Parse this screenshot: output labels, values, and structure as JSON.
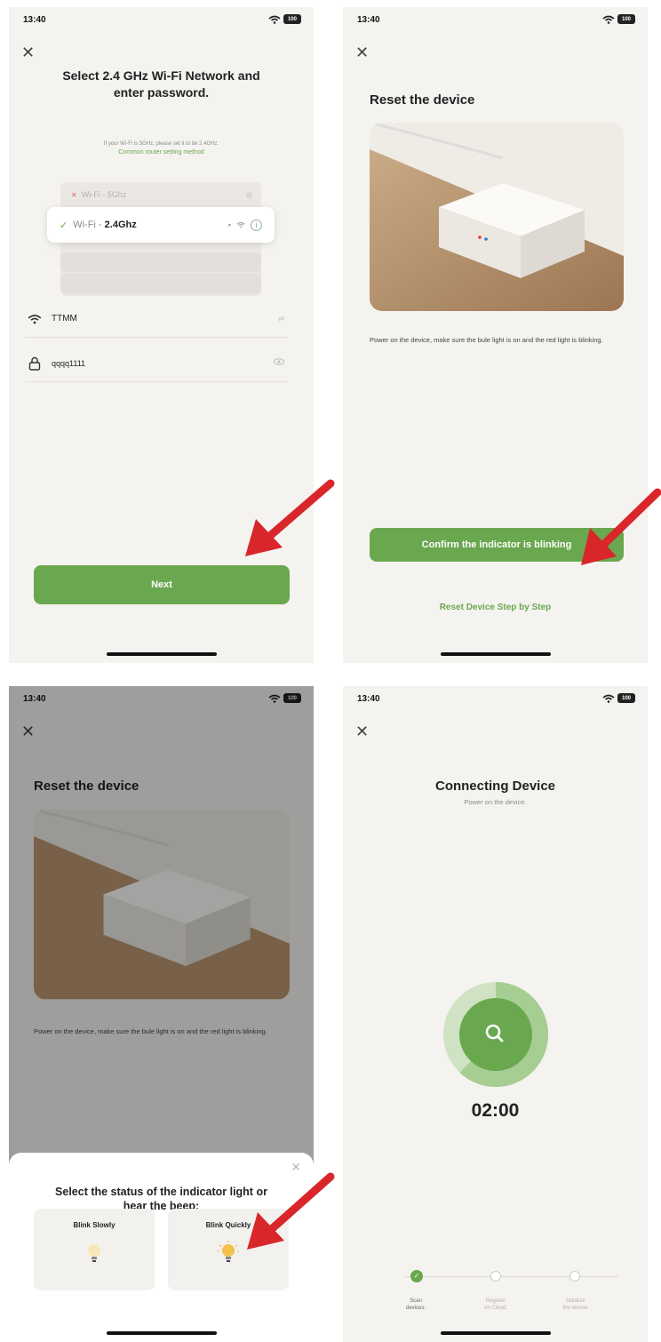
{
  "status_time": "13:40",
  "battery": "100",
  "panel1": {
    "title_line1": "Select 2.4 GHz Wi-Fi Network and",
    "title_line2": "enter password.",
    "hint": "If your Wi-Fi is 5GHz, please set it to be 2.4GHz.",
    "router_link": "Common router setting method",
    "wifi_5g_prefix": "Wi-Fi -",
    "wifi_5g_band": "5Ghz",
    "wifi_24_prefix": "Wi-Fi -",
    "wifi_24_band": "2.4Ghz",
    "ssid_value": "TTMM",
    "password_value": "qqqq1111",
    "next_label": "Next"
  },
  "panel2": {
    "title": "Reset the device",
    "description": "Power on the device, make sure the bule light is on and the red light is blinking.",
    "confirm_label": "Confirm the indicator is blinking",
    "step_by_step_label": "Reset Device Step by Step"
  },
  "panel3": {
    "title": "Reset the device",
    "description": "Power on the device, make sure the bule light is on and the red light is blinking.",
    "sheet_title_line1": "Select the status of the indicator light or",
    "sheet_title_line2": "hear the beep:",
    "option_slow": "Blink Slowly",
    "option_quick": "Blink Quickly"
  },
  "panel4": {
    "title": "Connecting Device",
    "subtitle": "Power on the device.",
    "timer": "02:00",
    "progress_fraction": 0.62,
    "step1_line1": "Scan",
    "step1_line2": "devices.",
    "step2_line1": "Register",
    "step2_line2": "on Cloud.",
    "step3_line1": "Initialize",
    "step3_line2": "the device."
  },
  "colors": {
    "accent_green": "#6aa84f",
    "arrow_red": "#d9262b",
    "background": "#f5f3f0"
  },
  "icons": [
    "close-icon",
    "wifi-icon",
    "lock-icon",
    "eye-icon",
    "search-icon",
    "check-icon",
    "lightbulb-icon",
    "location-arrow-icon",
    "battery-icon"
  ]
}
